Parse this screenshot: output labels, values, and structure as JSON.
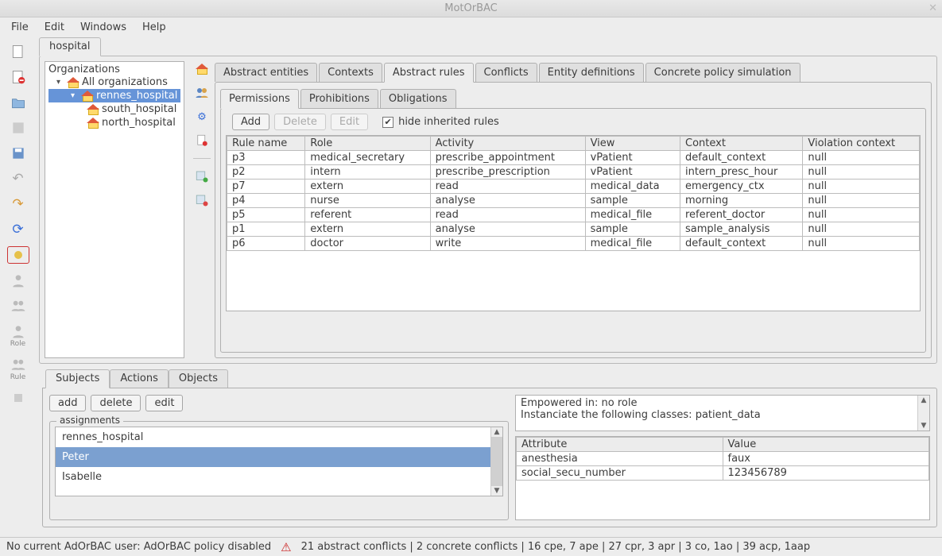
{
  "title": "MotOrBAC",
  "menubar": [
    "File",
    "Edit",
    "Windows",
    "Help"
  ],
  "policy_tab": "hospital",
  "tree": {
    "root": "Organizations",
    "all": "All organizations",
    "selected": "rennes_hospital",
    "children": [
      "south_hospital",
      "north_hospital"
    ]
  },
  "top_tabs": [
    "Abstract entities",
    "Contexts",
    "Abstract rules",
    "Conflicts",
    "Entity definitions",
    "Concrete policy simulation"
  ],
  "top_tabs_active": "Abstract rules",
  "rule_tabs": [
    "Permissions",
    "Prohibitions",
    "Obligations"
  ],
  "rule_tabs_active": "Permissions",
  "rule_buttons": {
    "add": "Add",
    "delete": "Delete",
    "edit": "Edit"
  },
  "hide_inherited": "hide inherited rules",
  "rule_columns": [
    "Rule name",
    "Role",
    "Activity",
    "View",
    "Context",
    "Violation context"
  ],
  "rules": [
    {
      "c": [
        "p3",
        "medical_secretary",
        "prescribe_appointment",
        "vPatient",
        "default_context",
        "null"
      ]
    },
    {
      "c": [
        "p2",
        "intern",
        "prescribe_prescription",
        "vPatient",
        "intern_presc_hour",
        "null"
      ]
    },
    {
      "c": [
        "p7",
        "extern",
        "read",
        "medical_data",
        "emergency_ctx",
        "null"
      ]
    },
    {
      "c": [
        "p4",
        "nurse",
        "analyse",
        "sample",
        "morning",
        "null"
      ]
    },
    {
      "c": [
        "p5",
        "referent",
        "read",
        "medical_file",
        "referent_doctor",
        "null"
      ]
    },
    {
      "c": [
        "p1",
        "extern",
        "analyse",
        "sample",
        "sample_analysis",
        "null"
      ]
    },
    {
      "c": [
        "p6",
        "doctor",
        "write",
        "medical_file",
        "default_context",
        "null"
      ]
    }
  ],
  "bottom_tabs": [
    "Subjects",
    "Actions",
    "Objects"
  ],
  "bottom_tabs_active": "Subjects",
  "bottom_buttons": {
    "add": "add",
    "delete": "delete",
    "edit": "edit"
  },
  "assignments_label": "assignments",
  "assignments": [
    "rennes_hospital",
    "Peter",
    "Isabelle"
  ],
  "assignments_selected": "Peter",
  "info_lines": [
    "Empowered in:  no role",
    "Instanciate the following classes: patient_data"
  ],
  "attr_columns": [
    "Attribute",
    "Value"
  ],
  "attributes": [
    {
      "a": "anesthesia",
      "v": "faux"
    },
    {
      "a": "social_secu_number",
      "v": "123456789"
    }
  ],
  "status": {
    "left": "No current AdOrBAC user: AdOrBAC policy disabled",
    "right": "21 abstract conflicts | 2 concrete conflicts | 16 cpe, 7 ape | 27 cpr, 3 apr | 3 co, 1ao | 39 acp, 1aap"
  }
}
